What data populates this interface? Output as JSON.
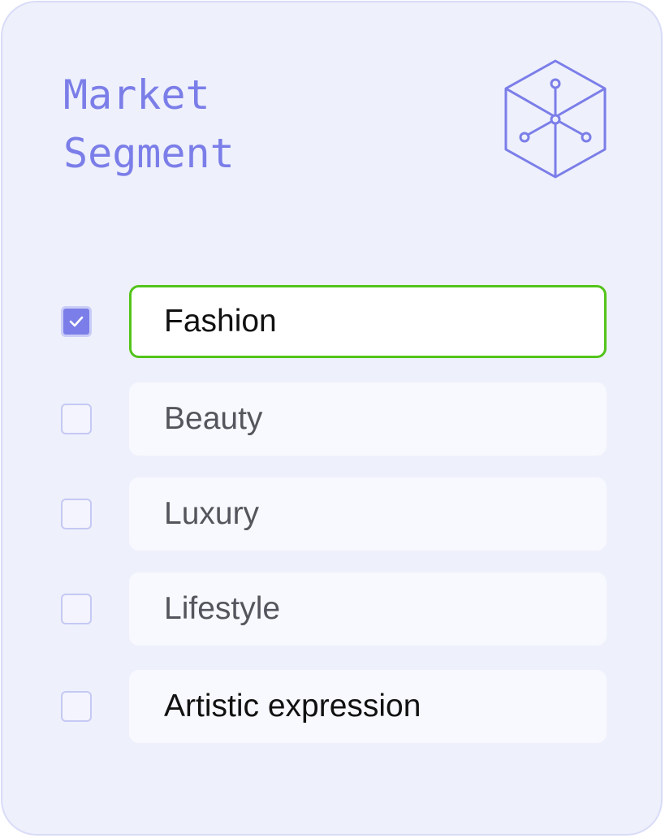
{
  "card": {
    "title_line1": "Market",
    "title_line2": "Segment",
    "icon": "network-cube-icon"
  },
  "colors": {
    "accent": "#7b7ee8",
    "selected_border": "#52c41a",
    "card_background": "#eef0fc",
    "option_background": "#f8f9fe"
  },
  "options": [
    {
      "label": "Fashion",
      "checked": true
    },
    {
      "label": "Beauty",
      "checked": false
    },
    {
      "label": "Luxury",
      "checked": false
    },
    {
      "label": "Lifestyle",
      "checked": false
    },
    {
      "label": "Artistic expression",
      "checked": false
    }
  ]
}
